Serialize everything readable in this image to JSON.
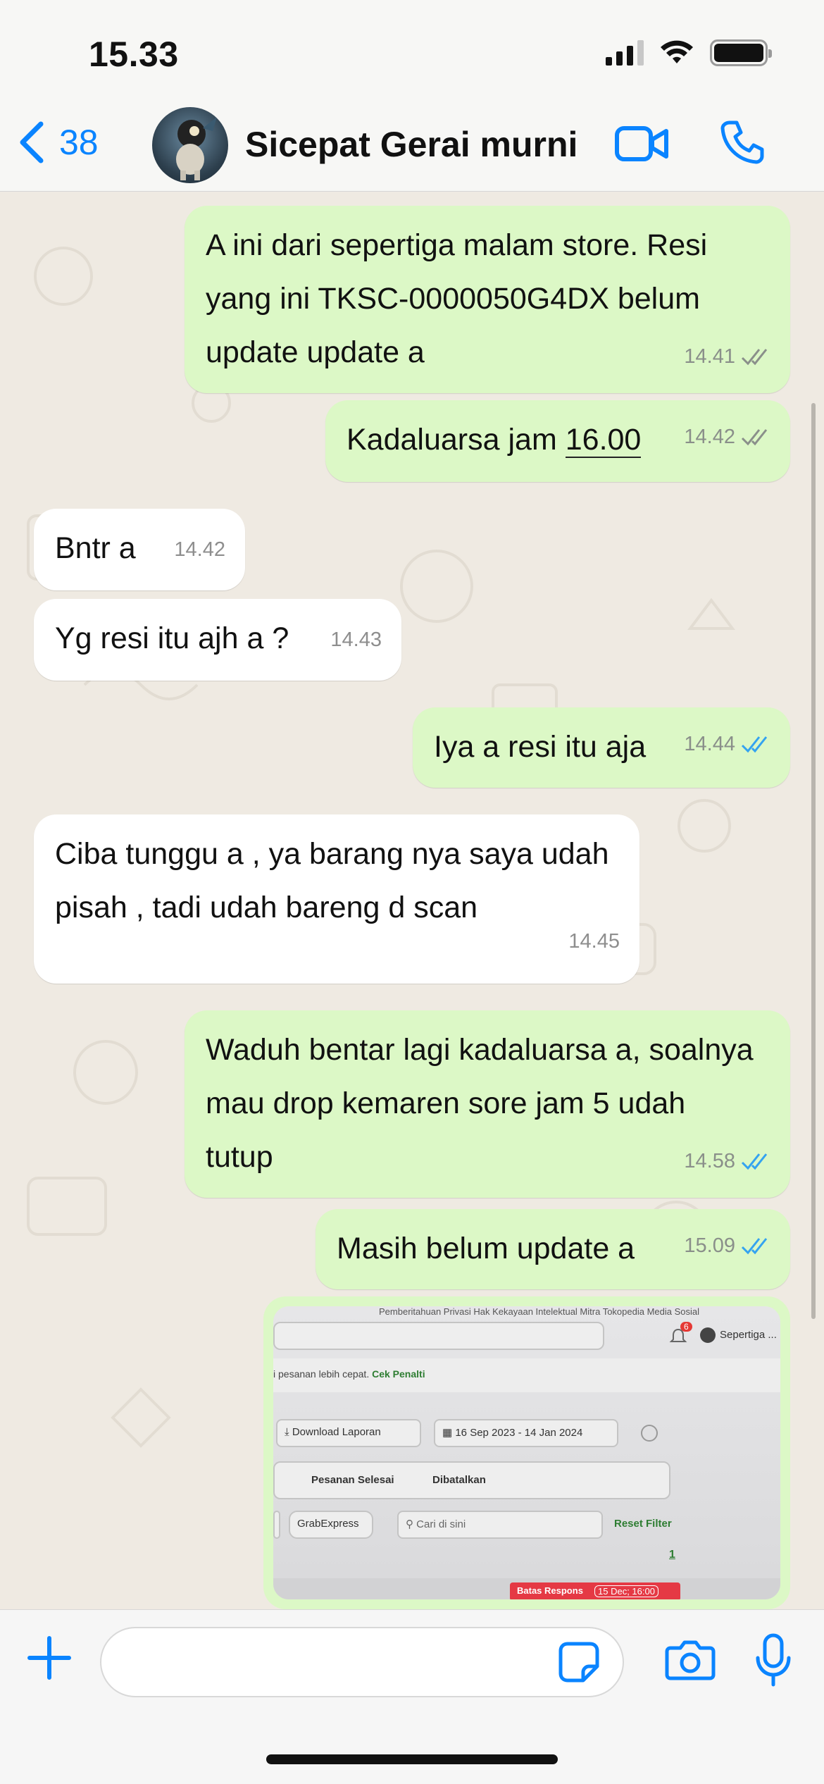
{
  "status": {
    "time": "15.33"
  },
  "header": {
    "back_count": "38",
    "title": "Sicepat Gerai murni"
  },
  "messages": [
    {
      "text": "A ini dari sepertiga malam store. Resi yang ini TKSC-0000050G4DX belum update update a",
      "time": "14.41",
      "status": "delivered"
    },
    {
      "text_prefix": "Kadaluarsa jam ",
      "text_link": "16.00",
      "time": "14.42",
      "status": "delivered"
    },
    {
      "text": "Bntr a",
      "time": "14.42"
    },
    {
      "text": "Yg resi itu ajh a ?",
      "time": "14.43"
    },
    {
      "text": "Iya a resi itu aja",
      "time": "14.44",
      "status": "read"
    },
    {
      "text": "Ciba tunggu a , ya barang nya saya udah pisah , tadi udah bareng d scan",
      "time": "14.45"
    },
    {
      "text": "Waduh bentar lagi kadaluarsa a, soalnya mau drop kemaren sore jam 5 udah tutup",
      "time": "14.58",
      "status": "read"
    },
    {
      "text": "Masih belum update a",
      "time": "15.09",
      "status": "read"
    }
  ],
  "screenshot": {
    "top_links": "Pemberitahuan Privasi    Hak Kekayaan Intelektual    Mitra Tokopedia    Media Sosial",
    "badge": "6",
    "store": "Sepertiga ...",
    "notice_prefix": "i pesanan lebih cepat. ",
    "notice_link": "Cek Penalti",
    "download": "Download Laporan",
    "date_range": "16 Sep 2023 - 14 Jan 2024",
    "tab_done": "Pesanan Selesai",
    "tab_cancel": "Dibatalkan",
    "chip": "GrabExpress",
    "search_placeholder": "Cari di sini",
    "reset": "Reset Filter",
    "page": "1",
    "deadline_label": "Batas Respons",
    "deadline_value": "15 Dec; 16:00"
  },
  "colors": {
    "accent": "#0a84ff",
    "outgoing": "#dcf8c6",
    "incoming": "#ffffff",
    "read_tick": "#34a3f0",
    "background": "#efeae2"
  }
}
